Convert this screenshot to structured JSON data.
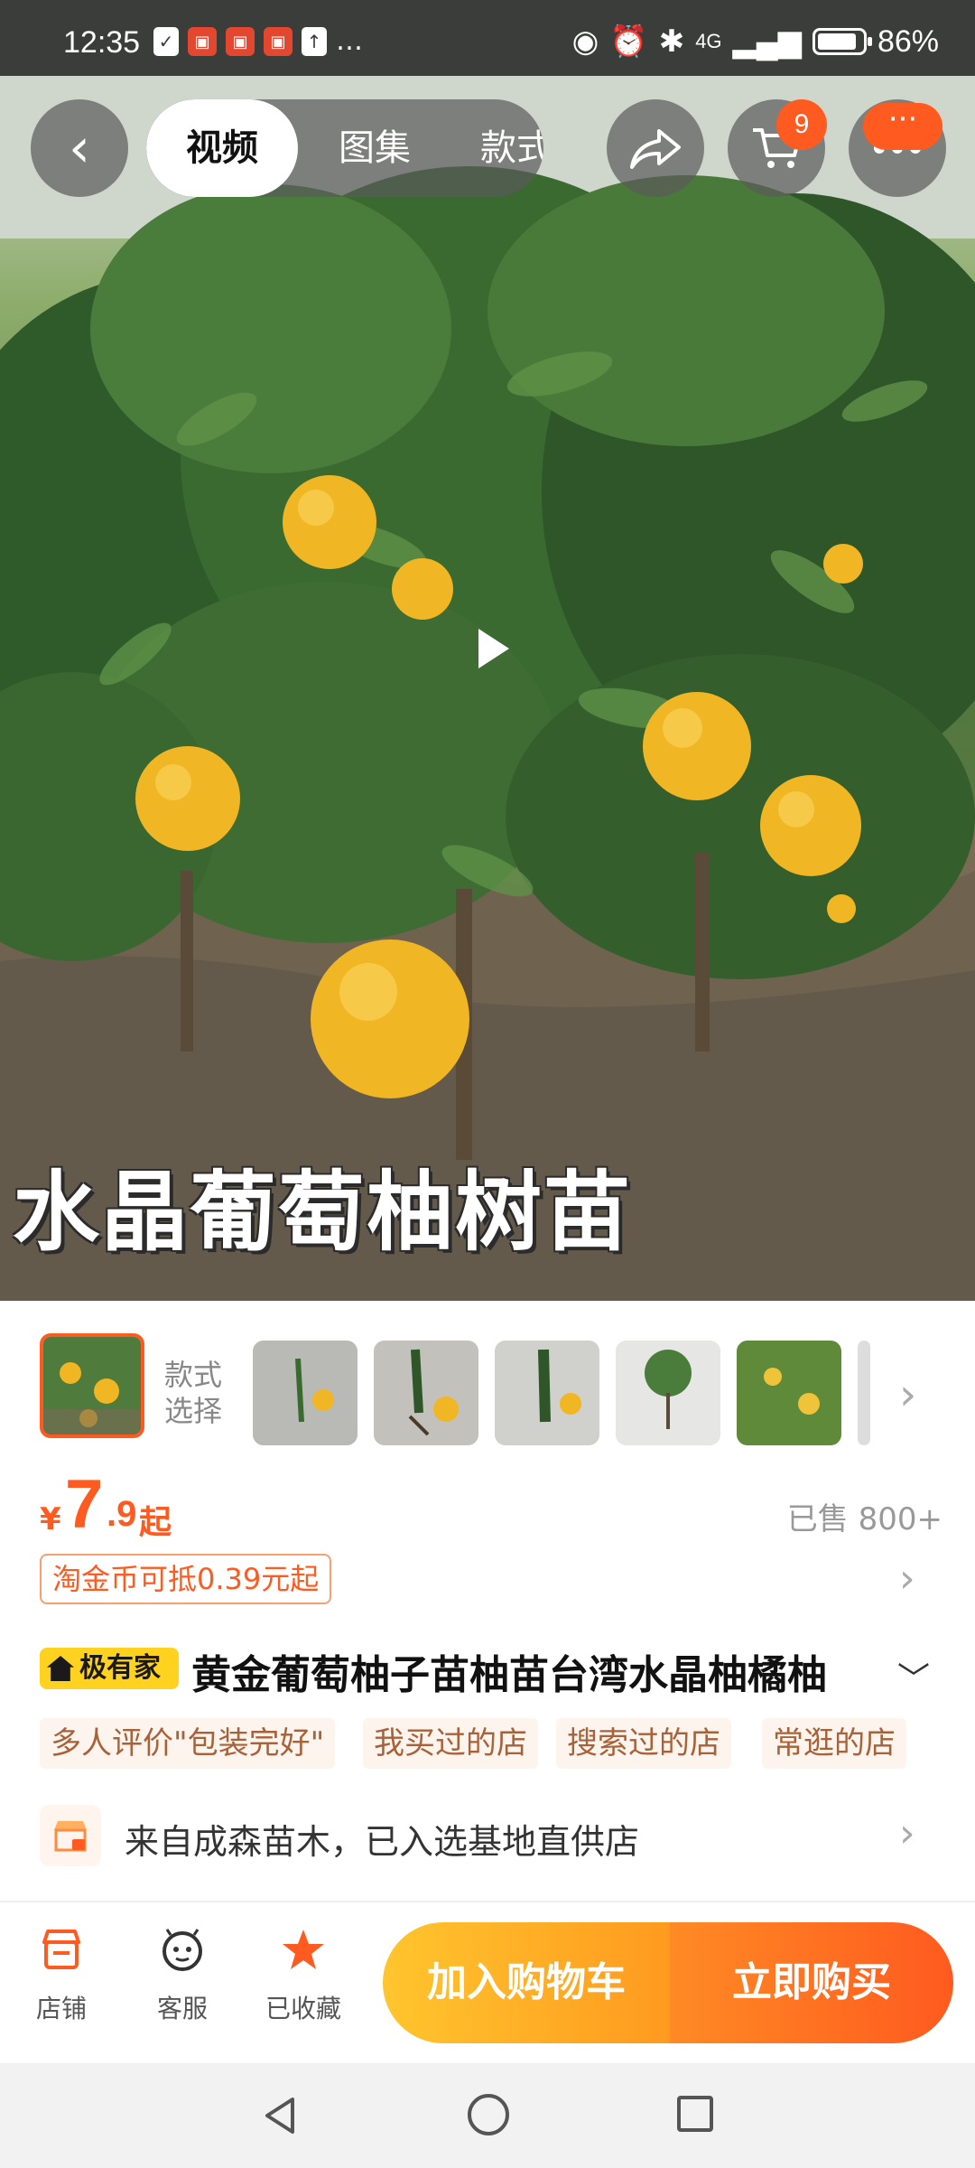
{
  "status_bar": {
    "time": "12:35",
    "battery_text": "86%",
    "network_label": "4G"
  },
  "header": {
    "back_icon": "chevron-left-icon",
    "tabs": [
      {
        "label": "视频",
        "active": true
      },
      {
        "label": "图集",
        "active": false
      },
      {
        "label": "款式",
        "active": false
      }
    ],
    "cart_badge": "9",
    "more_label": "···"
  },
  "hero": {
    "caption": "水晶葡萄柚树苗"
  },
  "thumbnails": {
    "style_label": "款式选择",
    "count": 7
  },
  "price": {
    "currency": "¥",
    "integer": "7",
    "decimal": ".9",
    "suffix": "起",
    "sold": "已售 800+",
    "coin_tag": "淘金币可抵0.39元起"
  },
  "product": {
    "brand_badge": "极有家",
    "title": "黄金葡萄柚子苗柚苗台湾水晶柚橘柚",
    "tags": [
      "多人评价\"包装完好\"",
      "我买过的店",
      "搜索过的店",
      "常逛的店"
    ],
    "store_text": "来自成森苗木，已入选基地直供店"
  },
  "actions": {
    "shop_label": "店铺",
    "service_label": "客服",
    "favorite_label": "已收藏",
    "add_cart_label": "加入购物车",
    "buy_now_label": "立即购买"
  },
  "colors": {
    "accent": "#ff5a1f",
    "cart_button": "#ffb020",
    "brand_yellow": "#ffd21f"
  }
}
